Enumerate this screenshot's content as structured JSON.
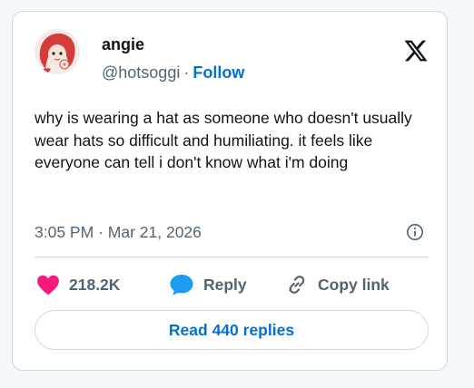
{
  "author": {
    "display_name": "angie",
    "handle": "@hotsoggi",
    "separator": "·",
    "follow_label": "Follow"
  },
  "tweet": {
    "text": "why is wearing a hat as someone who doesn't usually wear hats so difficult and humiliating. it feels like everyone can tell i don't know what i'm doing",
    "time": "3:05 PM",
    "date_separator": "·",
    "date": "Mar 21, 2026"
  },
  "actions": {
    "like_count": "218.2K",
    "reply_label": "Reply",
    "copy_link_label": "Copy link"
  },
  "read_replies_label": "Read 440 replies",
  "icons": {
    "like": "heart-icon",
    "reply": "speech-bubble-icon",
    "copy": "link-icon",
    "brand": "x-logo-icon",
    "info": "info-icon"
  },
  "colors": {
    "like": "#f91880",
    "reply": "#1d9bf0",
    "link": "#006fd6",
    "muted": "#536471",
    "text": "#0f1419",
    "border": "#cfd9de"
  }
}
